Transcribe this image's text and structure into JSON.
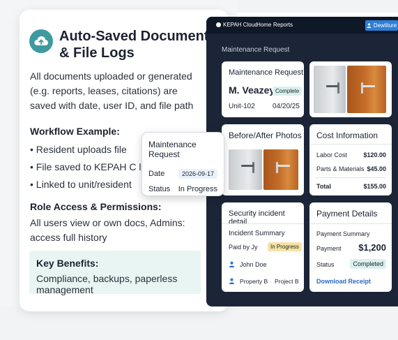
{
  "left": {
    "title": "Auto-Saved Documents & File Logs",
    "description": "All documents uploaded or generated (e.g. reports, leases, citations) are saved with date, user ID, and file path",
    "workflow_heading": "Workflow Example:",
    "workflow_items": [
      "• Resident uploads file",
      "• File saved to KEPAH C loud",
      "• Linked to unit/resident"
    ],
    "role_heading": "Role Access & Permissions:",
    "role_text": "All users view or own docs, Admins: access full history",
    "benefits_heading": "Key Benefits:",
    "benefits_text": "Compliance, backups, paperless management"
  },
  "floating_card": {
    "title": "Maintenance Request",
    "date_label": "Date",
    "date_value": "2026-09-17",
    "status_label": "Status",
    "status_value": "In Progress"
  },
  "nav": {
    "brand": "KEPAH Cloud",
    "links": [
      "Home",
      "Reports"
    ],
    "button": "Dewliture"
  },
  "section_title": "Maintenance Request",
  "maintenance": {
    "title": "Maintenance Request",
    "name": "M. Veazey",
    "status": "Complete",
    "unit": "Unit-102",
    "date": "04/20/25"
  },
  "photos": {
    "title": "Before/After Photos"
  },
  "cost": {
    "title": "Cost Information",
    "rows": [
      {
        "label": "Labor Cost",
        "value": "$120.00"
      },
      {
        "label": "Parts & Materials",
        "value": "$45.00"
      }
    ],
    "total_label": "Total",
    "total_value": "$155.00"
  },
  "security": {
    "title": "Security incident detail",
    "summary": "Incident Summary",
    "paid_by": "Paid by Jy",
    "status": "In Progress",
    "person": "John Doe",
    "property": "Property B",
    "project": "Project B"
  },
  "payment": {
    "title": "Payment Details",
    "summary": "Payment Summary",
    "payment_label": "Payment",
    "payment_value": "$1,200",
    "status_label": "Status",
    "status_value": "Completed",
    "link": "Download Receipt"
  },
  "colors": {
    "accent": "#3e9aa0",
    "dashboard_bg": "#1b2537",
    "nav_button": "#2f7fd6",
    "in_progress": "#f5e3a3",
    "complete": "#d9f0ec",
    "link": "#2a68c4"
  }
}
